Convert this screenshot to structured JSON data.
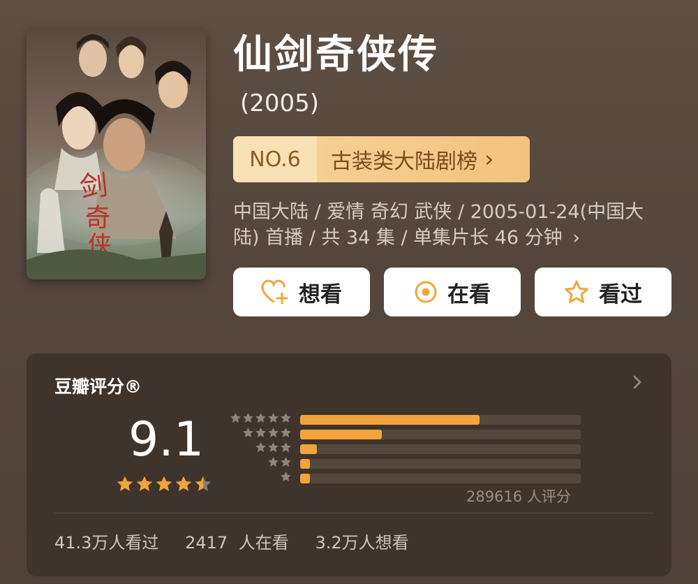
{
  "title": "仙剑奇侠传",
  "year": "(2005)",
  "rank": {
    "number": "NO.6",
    "label": "古装类大陆剧榜",
    "arrow": "›"
  },
  "meta": {
    "line1": "中国大陆 / 爱情 奇幻 武侠 / 2005-01-24(中国大",
    "line2": "陆) 首播 / 共 34 集 / 单集片长 46 分钟",
    "arrow": "›"
  },
  "buttons": {
    "want": {
      "label": "想看",
      "icon": "heart-plus-icon"
    },
    "watching": {
      "label": "在看",
      "icon": "target-icon"
    },
    "watched": {
      "label": "看过",
      "icon": "star-outline-icon"
    }
  },
  "rating": {
    "title": "豆瓣评分®",
    "score": "9.1",
    "stars": 4.5,
    "breakdown": [
      {
        "stars": 5,
        "fraction": 0.64
      },
      {
        "stars": 4,
        "fraction": 0.29
      },
      {
        "stars": 3,
        "fraction": 0.06
      },
      {
        "stars": 2,
        "fraction": 0.03
      },
      {
        "stars": 1,
        "fraction": 0.03
      }
    ],
    "count_text": "289616 人评分"
  },
  "stats": {
    "watched": "41.3万人看过",
    "watching": "2417 人在看",
    "want": "3.2万人想看"
  },
  "colors": {
    "accent": "#f2a43a",
    "rank_bg": "#f3c98a",
    "card_bg": "#3f342c"
  }
}
